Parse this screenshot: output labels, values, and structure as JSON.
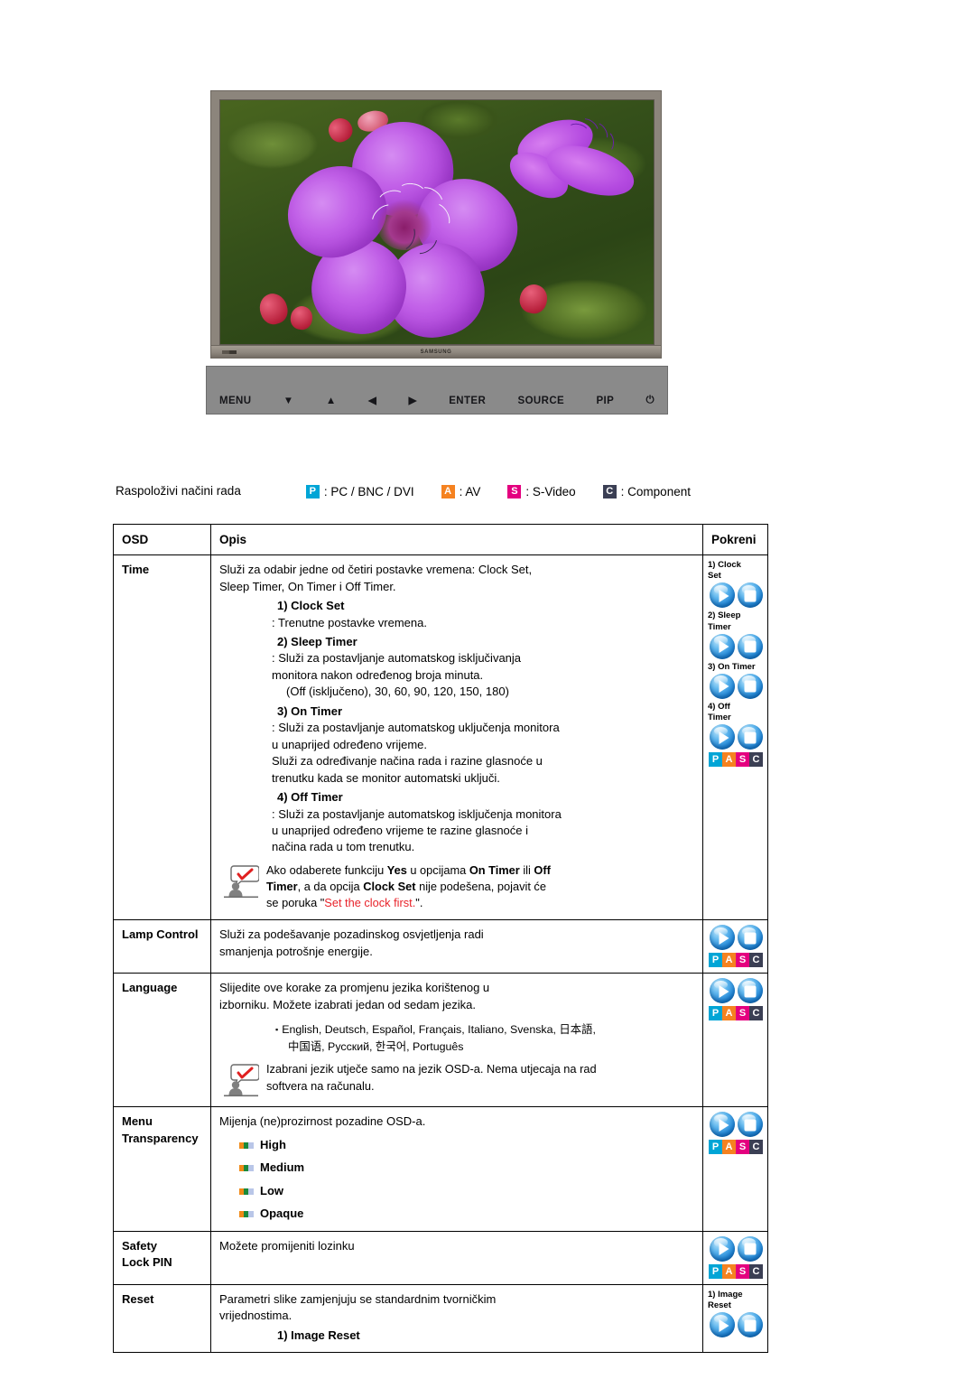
{
  "monitor": {
    "brand": "SAMSUNG",
    "controls": [
      {
        "name": "menu",
        "label": "MENU",
        "type": "text"
      },
      {
        "name": "down",
        "label": "▼",
        "type": "glyph"
      },
      {
        "name": "up",
        "label": "▲",
        "type": "glyph"
      },
      {
        "name": "left",
        "label": "◀",
        "type": "glyph"
      },
      {
        "name": "right",
        "label": "▶",
        "type": "glyph"
      },
      {
        "name": "enter",
        "label": "ENTER",
        "type": "text"
      },
      {
        "name": "source",
        "label": "SOURCE",
        "type": "text"
      },
      {
        "name": "pip",
        "label": "PIP",
        "type": "text"
      },
      {
        "name": "power",
        "label": "⏻",
        "type": "power"
      }
    ]
  },
  "modes": {
    "label": "Raspoloživi načini rada",
    "items": [
      {
        "badge": "P",
        "color": "#00a5d6",
        "text": ": PC / BNC / DVI"
      },
      {
        "badge": "A",
        "color": "#f58220",
        "text": ": AV"
      },
      {
        "badge": "S",
        "color": "#e4007f",
        "text": ": S-Video"
      },
      {
        "badge": "C",
        "color": "#3b3f54",
        "text": ": Component"
      }
    ]
  },
  "table": {
    "headers": {
      "osd": "OSD",
      "opis": "Opis",
      "pokreni": "Pokreni"
    },
    "rows": [
      {
        "osd": "Time",
        "intro": "Služi za odabir jedne od četiri postavke vremena: Clock Set,\nSleep Timer, On Timer i Off Timer.",
        "items": [
          {
            "head": "1) Clock Set",
            "body": ": Trenutne postavke vremena."
          },
          {
            "head": "2) Sleep Timer",
            "body": ": Služi za postavljanje automatskog isključivanja\nmonitora nakon određenog broja minuta.",
            "paren": "(Off (isključeno), 30, 60, 90, 120, 150, 180)"
          },
          {
            "head": "3) On Timer",
            "body": ": Služi za postavljanje automatskog uključenja monitora\nu unaprijed određeno vrijeme.\nSluži za određivanje načina rada i razine glasnoće u\ntrenutku kada se monitor automatski uključi."
          },
          {
            "head": "4) Off Timer",
            "body": ": Služi za postavljanje automatskog isključenja monitora\nu unaprijed određeno vrijeme te razine glasnoće i\nnačina rada u tom trenutku."
          }
        ],
        "note": {
          "parts": [
            {
              "t": "Ako odaberete funkciju ",
              "b": false
            },
            {
              "t": "Yes",
              "b": true
            },
            {
              "t": " u opcijama ",
              "b": false
            },
            {
              "t": "On Timer",
              "b": true
            },
            {
              "t": " ili ",
              "b": false
            },
            {
              "t": "Off",
              "b": true
            },
            {
              "t": "\n",
              "b": false
            },
            {
              "t": "Timer",
              "b": true
            },
            {
              "t": ", a da opcija ",
              "b": false
            },
            {
              "t": "Clock Set",
              "b": true
            },
            {
              "t": " nije podešena, pojavit će",
              "b": false
            },
            {
              "t": "\n",
              "b": false
            },
            {
              "t": "se poruka \"",
              "b": false
            },
            {
              "t": "Set the clock first.",
              "b": false,
              "red": true
            },
            {
              "t": "\".",
              "b": false
            }
          ]
        },
        "pokreni": {
          "groups": [
            {
              "label": "1) Clock\nSet",
              "buttons": [
                "play",
                "enter"
              ]
            },
            {
              "label": "2) Sleep\nTimer",
              "buttons": [
                "play",
                "enter"
              ]
            },
            {
              "label": "3) On Timer",
              "buttons": [
                "play",
                "enter"
              ]
            },
            {
              "label": "4) Off\nTimer",
              "buttons": [
                "play",
                "enter"
              ]
            }
          ],
          "pasc": true
        }
      },
      {
        "osd": "Lamp Control",
        "intro": "Služi za podešavanje pozadinskog osvjetljenja radi\nsmanjenja potrošnje energije.",
        "items": [],
        "pokreni": {
          "groups": [
            {
              "label": "",
              "buttons": [
                "play",
                "enter"
              ]
            }
          ],
          "pasc": true
        }
      },
      {
        "osd": "Language",
        "intro": "Slijedite ove korake za promjenu jezika korištenog u\nizborniku. Možete izabrati jedan od sedam jezika.",
        "languages_line1": "English, Deutsch, Español, Français, Italiano, Svenska, 日本語,",
        "languages_line2": "中国语, Русский, 한국어,  Português",
        "items": [],
        "note": {
          "parts": [
            {
              "t": "Izabrani jezik utječe samo na jezik OSD-a. Nema utjecaja na rad",
              "b": false
            },
            {
              "t": "\n",
              "b": false
            },
            {
              "t": "softvera na računalu.",
              "b": false
            }
          ]
        },
        "pokreni": {
          "groups": [
            {
              "label": "",
              "buttons": [
                "play",
                "enter"
              ]
            }
          ],
          "pasc": true
        }
      },
      {
        "osd": "Menu\nTransparency",
        "intro": "Mijenja (ne)prozirnost pozadine OSD-a.",
        "options": [
          "High",
          "Medium",
          "Low",
          "Opaque"
        ],
        "items": [],
        "pokreni": {
          "groups": [
            {
              "label": "",
              "buttons": [
                "play",
                "enter"
              ]
            }
          ],
          "pasc": true
        }
      },
      {
        "osd": "Safety\nLock PIN",
        "intro": "Možete promijeniti lozinku",
        "items": [],
        "pokreni": {
          "groups": [
            {
              "label": "",
              "buttons": [
                "play",
                "enter"
              ]
            }
          ],
          "pasc": true
        }
      },
      {
        "osd": "Reset",
        "intro": "Parametri slike zamjenjuju se standardnim tvorničkim\nvrijednostima.",
        "items": [
          {
            "head": "1) Image Reset",
            "body": ""
          }
        ],
        "pokreni": {
          "groups": [
            {
              "label": "1) Image\nReset",
              "buttons": [
                "play",
                "enter"
              ]
            }
          ],
          "pasc": false
        }
      }
    ]
  },
  "pasc_badges": [
    {
      "letter": "P",
      "color": "#00a5d6"
    },
    {
      "letter": "A",
      "color": "#f58220"
    },
    {
      "letter": "S",
      "color": "#e4007f"
    },
    {
      "letter": "C",
      "color": "#3b3f54"
    }
  ]
}
